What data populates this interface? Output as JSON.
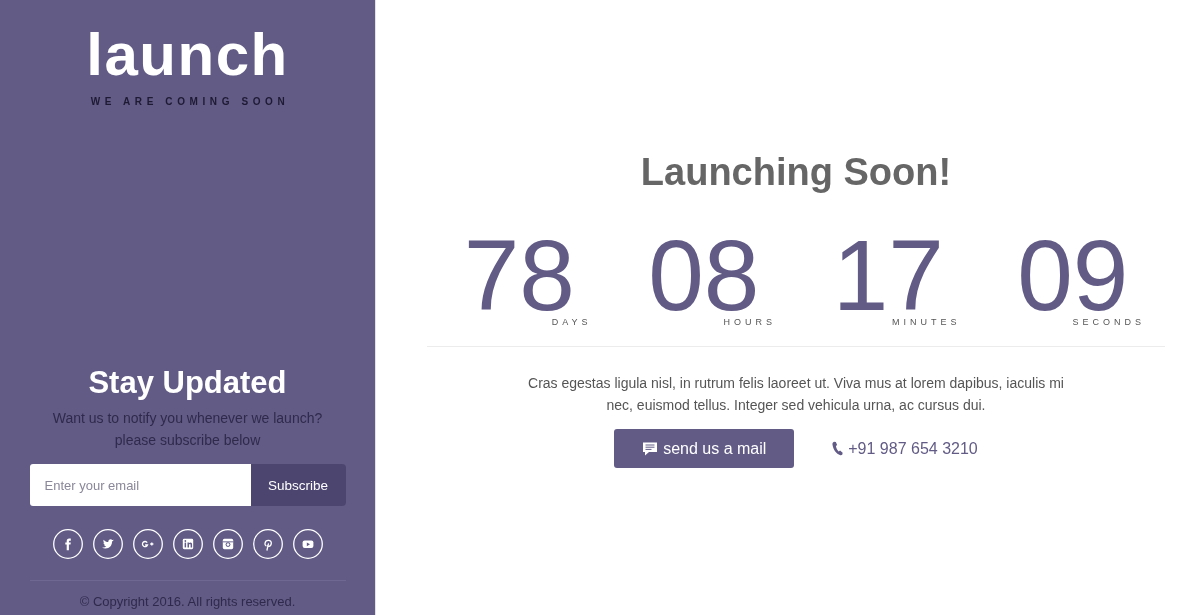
{
  "sidebar": {
    "logo": "launch",
    "tagline": "WE ARE COMING SOON",
    "heading": "Stay Updated",
    "subtitle": "Want us to notify you whenever we launch? please subscribe below",
    "email_field": {
      "placeholder": "Enter your email"
    },
    "subscribe_button": "Subscribe",
    "social": [
      {
        "kind": "facebook"
      },
      {
        "kind": "twitter"
      },
      {
        "kind": "googleplus"
      },
      {
        "kind": "linkedin"
      },
      {
        "kind": "instagram"
      },
      {
        "kind": "pinterest"
      },
      {
        "kind": "youtube"
      }
    ],
    "copyright": "© Copyright 2016. All rights reserved."
  },
  "main": {
    "title": "Launching Soon!",
    "countdown": [
      {
        "value": "78",
        "unit": "DAYS"
      },
      {
        "value": "08",
        "unit": "HOURS"
      },
      {
        "value": "17",
        "unit": "MINUTES"
      },
      {
        "value": "09",
        "unit": "SECONDS"
      }
    ],
    "description": "Cras egestas ligula nisl, in rutrum felis laoreet ut. Viva mus at lorem dapibus, iaculis mi nec, euismod tellus. Integer sed vehicula urna, ac cursus dui.",
    "mail_button": "send us a mail",
    "phone": "+91 987 654 3210"
  }
}
